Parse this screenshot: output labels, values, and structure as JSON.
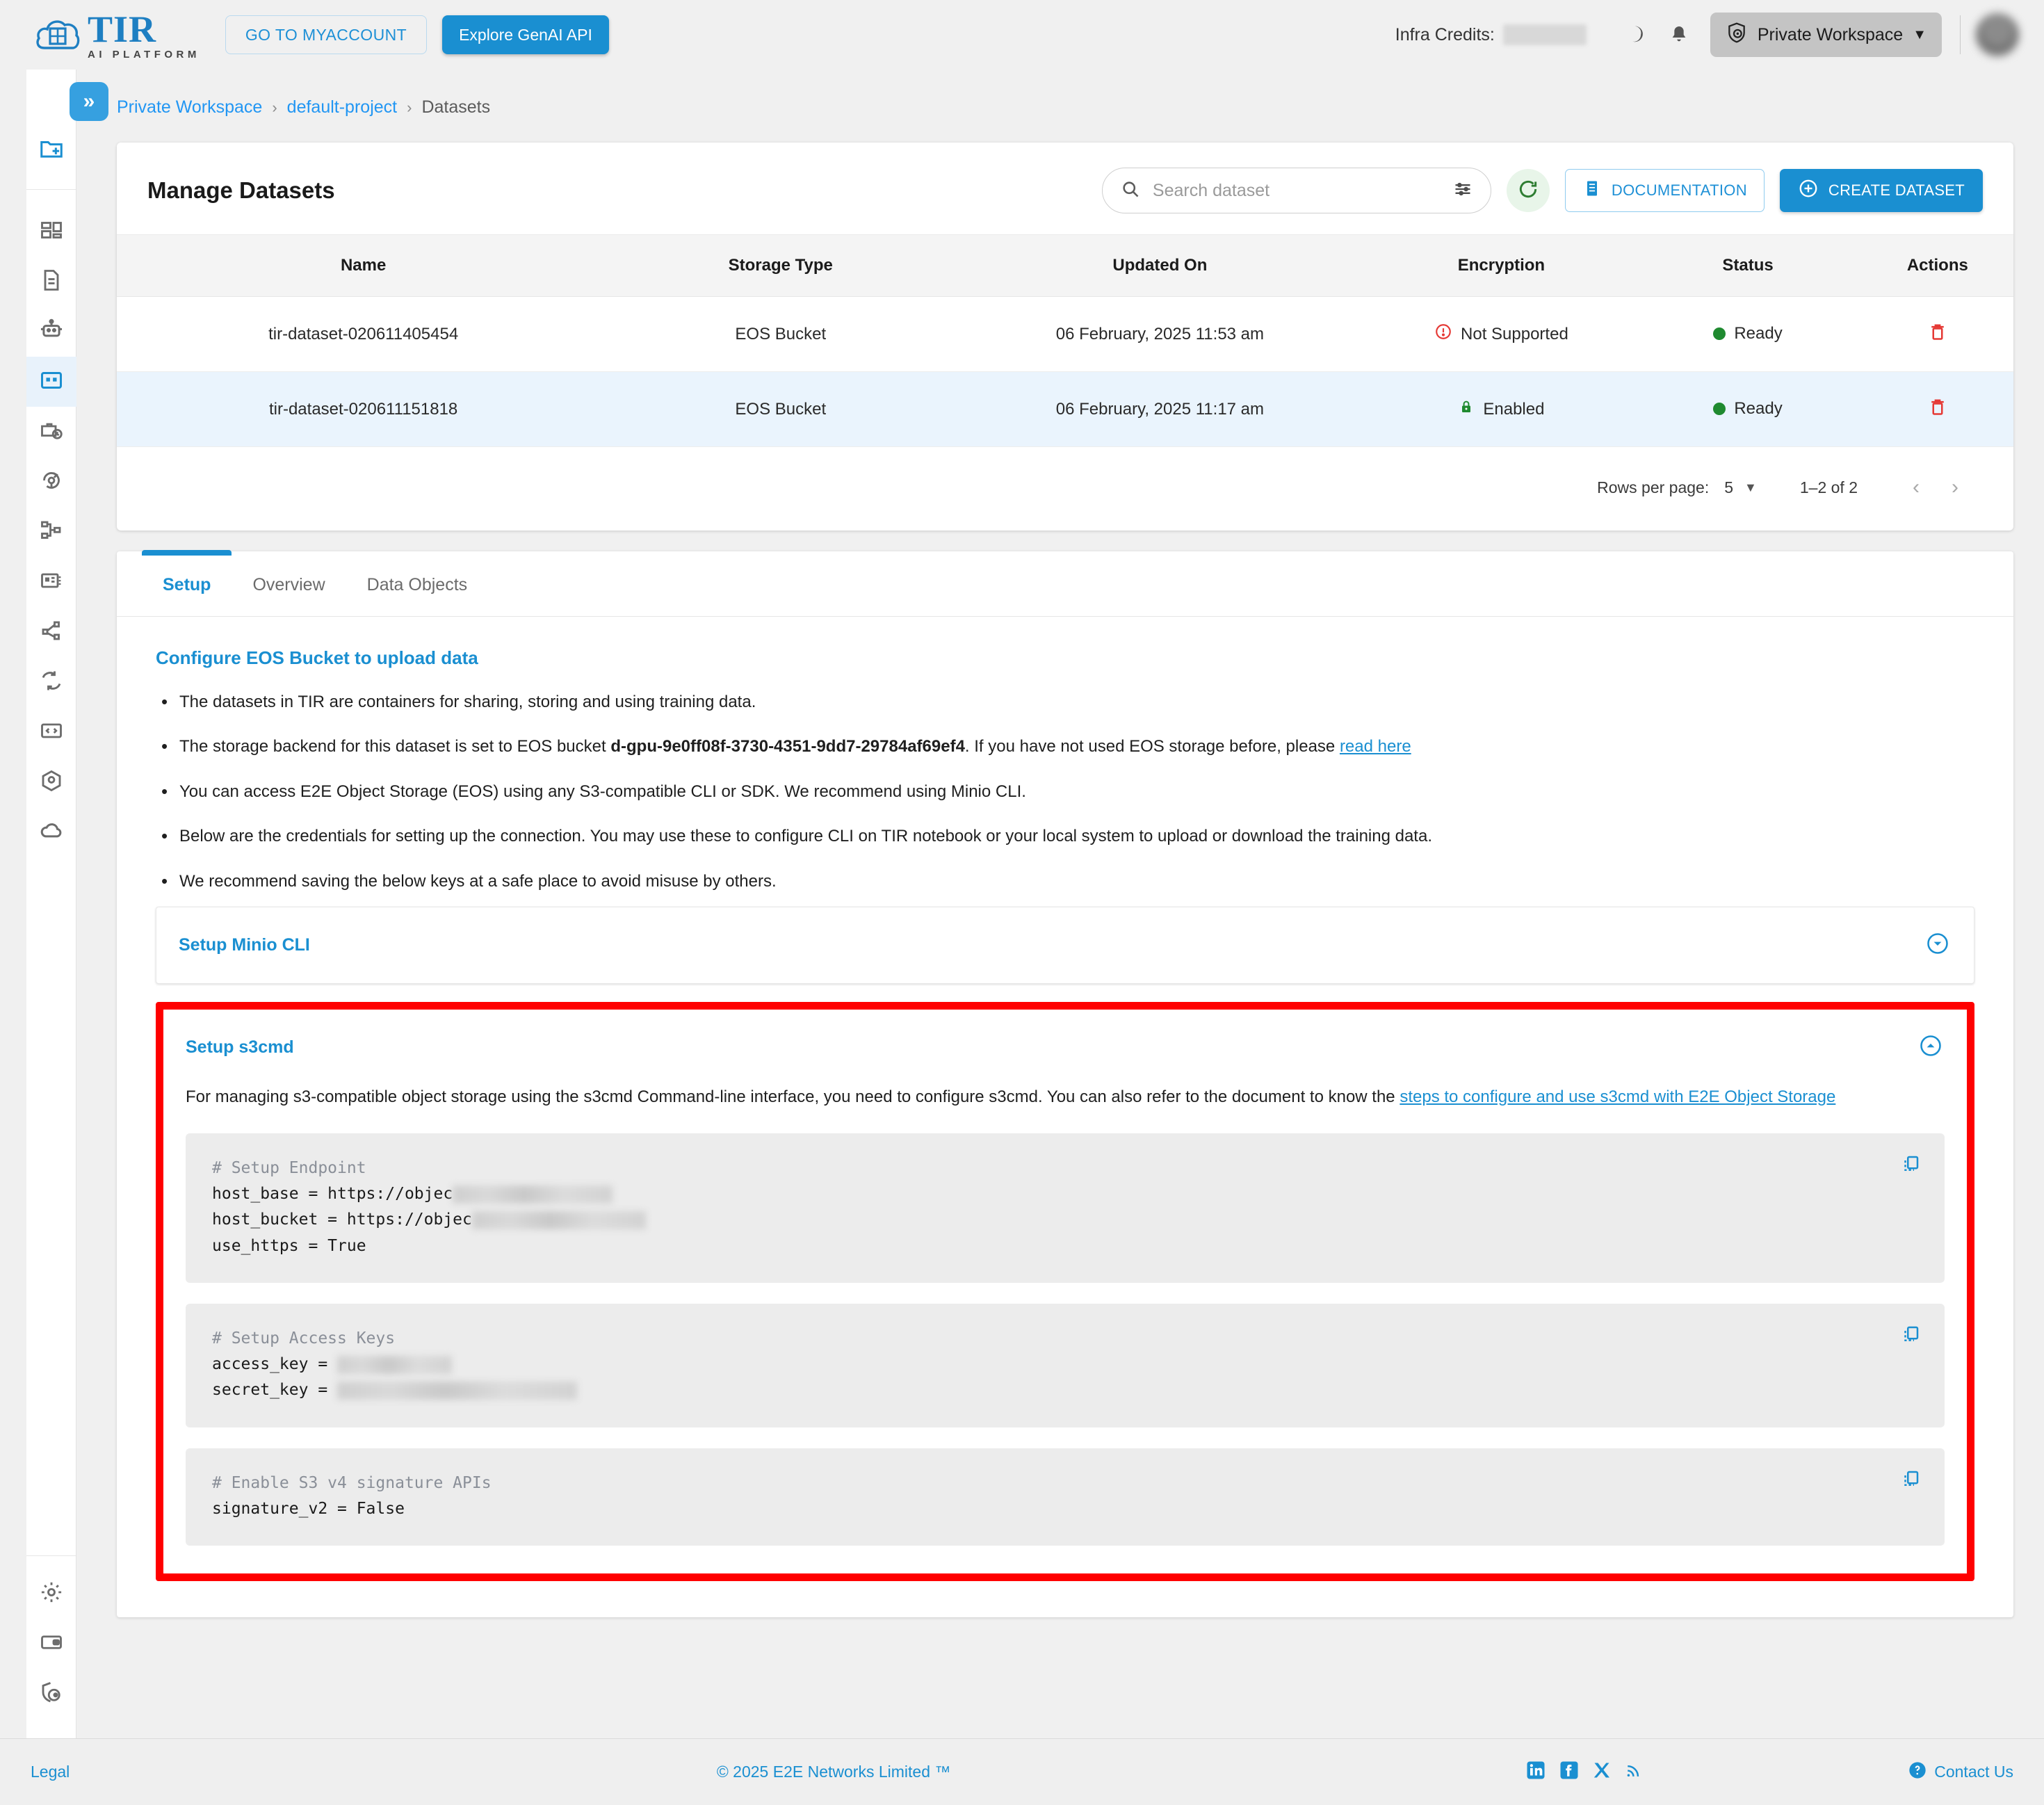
{
  "brand": {
    "name": "TIR",
    "subtitle": "AI PLATFORM",
    "logo_badge": "E2E Cloud"
  },
  "topbar": {
    "myaccount_label": "GO TO MYACCOUNT",
    "genai_label": "Explore GenAI API",
    "credits_label": "Infra Credits:",
    "credits_value_redacted": true,
    "dark_mode_icon": "moon-icon",
    "notifications_icon": "bell-icon",
    "workspace_label": "Private Workspace",
    "workspace_icon": "shield-user-icon",
    "workspace_caret": "▼"
  },
  "sidebar": {
    "collapse_icon": "»",
    "new_item": {
      "name": "folder-plus-icon"
    },
    "items": [
      {
        "name": "dashboard-icon",
        "active": false
      },
      {
        "name": "document-icon",
        "active": false
      },
      {
        "name": "bot-icon",
        "active": false
      },
      {
        "name": "datasets-grid-icon",
        "active": true
      },
      {
        "name": "jobs-briefcase-clock-icon",
        "active": false
      },
      {
        "name": "pipeline-refresh-icon",
        "active": false
      },
      {
        "name": "model-tree-icon",
        "active": false
      },
      {
        "name": "inference-card-icon",
        "active": false
      },
      {
        "name": "share-nodes-icon",
        "active": false
      },
      {
        "name": "sync-icon",
        "active": false
      },
      {
        "name": "code-window-icon",
        "active": false
      },
      {
        "name": "container-box-icon",
        "active": false
      },
      {
        "name": "cloud-icon",
        "active": false
      }
    ],
    "bottom_items": [
      {
        "name": "gear-icon"
      },
      {
        "name": "wallet-icon"
      },
      {
        "name": "shield-user-icon"
      }
    ]
  },
  "breadcrumb": {
    "items": [
      {
        "label": "Private Workspace",
        "link": true
      },
      {
        "label": "default-project",
        "link": true
      },
      {
        "label": "Datasets",
        "link": false
      }
    ],
    "separator": "›"
  },
  "page": {
    "title": "Manage Datasets"
  },
  "search": {
    "placeholder": "Search dataset",
    "value": "",
    "icon": "search-icon",
    "filter_icon": "filter-sliders-icon"
  },
  "toolbar": {
    "refresh_icon": "refresh-icon",
    "documentation_label": "DOCUMENTATION",
    "documentation_icon": "book-icon",
    "create_label": "CREATE DATASET",
    "create_icon": "plus-circle-icon"
  },
  "table": {
    "columns": [
      "Name",
      "Storage Type",
      "Updated On",
      "Encryption",
      "Status",
      "Actions"
    ],
    "rows": [
      {
        "name": "tir-dataset-020611405454",
        "storage_type": "EOS Bucket",
        "updated_on": "06 February, 2025 11:53 am",
        "encryption": "Not Supported",
        "encryption_icon": "alert-circle-icon",
        "status": "Ready",
        "action_icon": "delete-trash-icon",
        "selected": false
      },
      {
        "name": "tir-dataset-020611151818",
        "storage_type": "EOS Bucket",
        "updated_on": "06 February, 2025 11:17 am",
        "encryption": "Enabled",
        "encryption_icon": "lock-icon",
        "status": "Ready",
        "action_icon": "delete-trash-icon",
        "selected": true
      }
    ]
  },
  "pagination": {
    "rows_per_page_label": "Rows per page:",
    "rows_per_page_value": "5",
    "caret": "▼",
    "range_label": "1–2 of 2",
    "prev_icon": "chevron-left-icon",
    "next_icon": "chevron-right-icon"
  },
  "tabs": [
    {
      "label": "Setup",
      "active": true
    },
    {
      "label": "Overview",
      "active": false
    },
    {
      "label": "Data Objects",
      "active": false
    }
  ],
  "setup": {
    "heading": "Configure EOS Bucket to upload data",
    "bullets": [
      {
        "text": "The datasets in TIR are containers for sharing, storing and using training data."
      },
      {
        "prefix": "The storage backend for this dataset is set to EOS bucket ",
        "bold": "d-gpu-9e0ff08f-3730-4351-9dd7-29784af69ef4",
        "middle": ". If you have not used EOS storage before, please ",
        "link": "read here"
      },
      {
        "text": "You can access E2E Object Storage (EOS) using any S3-compatible CLI or SDK. We recommend using Minio CLI."
      },
      {
        "text": "Below are the credentials for setting up the connection. You may use these to configure CLI on TIR notebook or your local system to upload or download the training data."
      },
      {
        "text": "We recommend saving the below keys at a safe place to avoid misuse by others."
      }
    ],
    "minio": {
      "title": "Setup Minio CLI",
      "expanded": false,
      "toggle_icon": "chevron-down-circle-icon"
    },
    "s3cmd": {
      "title": "Setup s3cmd",
      "expanded": true,
      "toggle_icon": "chevron-up-circle-icon",
      "highlighted": true,
      "highlight_color": "#ff0000",
      "description_prefix": "For managing s3-compatible object storage using the s3cmd Command-line interface, you need to configure s3cmd. You can also refer to the document to know the ",
      "description_link": "steps to configure and use s3cmd with E2E Object Storage",
      "code_blocks": [
        {
          "comment": "# Setup Endpoint",
          "copy_icon": "copy-icon",
          "lines": [
            {
              "key": "host_base = https://objec",
              "redacted": true,
              "redacted_width": 230
            },
            {
              "key": "host_bucket = https://objec",
              "redacted": true,
              "redacted_width": 250
            },
            {
              "key": "use_https = True",
              "redacted": false
            }
          ]
        },
        {
          "comment": "# Setup Access Keys",
          "copy_icon": "copy-icon",
          "lines": [
            {
              "key": "access_key = ",
              "redacted": true,
              "redacted_width": 165
            },
            {
              "key": "secret_key = ",
              "redacted": true,
              "redacted_width": 345
            }
          ]
        },
        {
          "comment": "# Enable S3 v4 signature APIs",
          "copy_icon": "copy-icon",
          "lines": [
            {
              "key": "signature_v2 = False",
              "redacted": false
            }
          ]
        }
      ]
    }
  },
  "footer": {
    "legal_label": "Legal",
    "copyright": "© 2025 E2E Networks Limited ™",
    "socials": [
      {
        "name": "linkedin-icon"
      },
      {
        "name": "facebook-icon"
      },
      {
        "name": "x-twitter-icon"
      },
      {
        "name": "rss-icon"
      }
    ],
    "contact_label": "Contact Us",
    "contact_icon": "help-circle-icon"
  },
  "colors": {
    "accent": "#1a8fd1",
    "link": "#2196f3",
    "success": "#1f8a30",
    "danger": "#e53935",
    "highlight": "#ff0000"
  }
}
